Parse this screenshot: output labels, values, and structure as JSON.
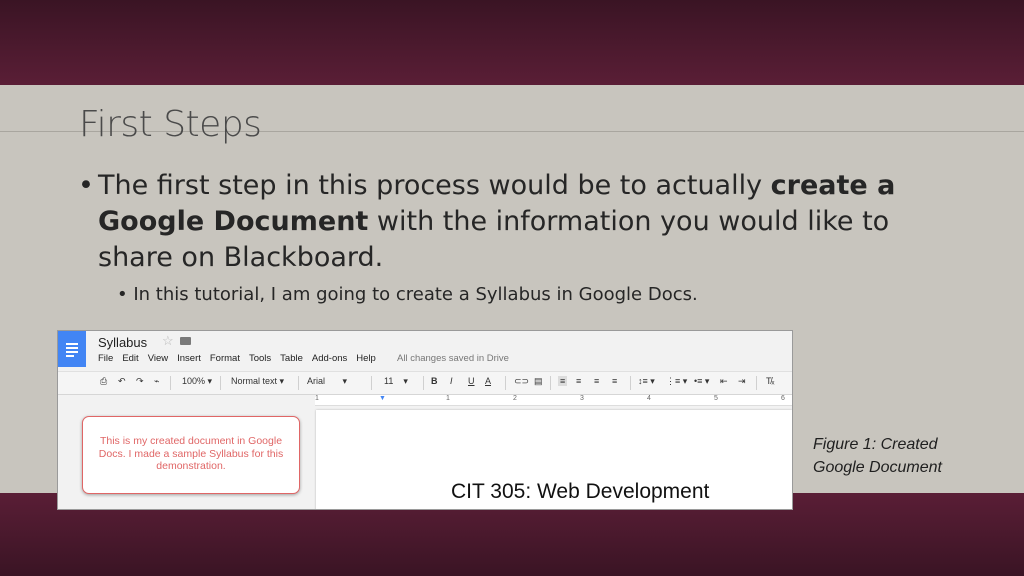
{
  "slide": {
    "title": "First Steps",
    "bullet_main": {
      "part1": "The first step in this process would be to actually ",
      "bold": "create a Google Document",
      "part2": " with the information you would like to share on Blackboard."
    },
    "bullet_sub": "In this tutorial, I am going to create a Syllabus in Google Docs.",
    "caption": "Figure 1: Created Google Document"
  },
  "docs": {
    "doc_title": "Syllabus",
    "menu": [
      "File",
      "Edit",
      "View",
      "Insert",
      "Format",
      "Tools",
      "Table",
      "Add-ons",
      "Help"
    ],
    "saved_status": "All changes saved in Drive",
    "toolbar": {
      "zoom": "100%",
      "style": "Normal text",
      "font": "Arial",
      "size": "11",
      "bold": "B",
      "italic": "I",
      "underline": "U",
      "text_color": "A"
    },
    "ruler_numbers": [
      "1",
      "1",
      "2",
      "3",
      "4",
      "5",
      "6"
    ],
    "comment": "This is my created document in Google Docs. I made a sample Syllabus for this demonstration.",
    "page_heading": "CIT 305: Web Development"
  },
  "colors": {
    "accent_band": "#5a1e36",
    "slide_bg": "#c8c5be",
    "comment_red": "#e06666",
    "docs_blue": "#4285f4"
  }
}
